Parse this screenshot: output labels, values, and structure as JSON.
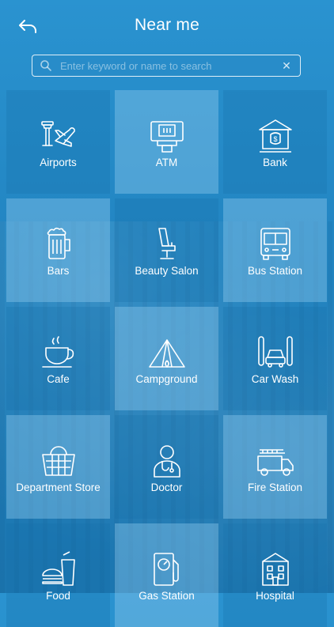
{
  "header": {
    "title": "Near me",
    "back_icon": "back-arrow-icon"
  },
  "search": {
    "placeholder": "Enter keyword or name to search",
    "value": ""
  },
  "categories": [
    {
      "label": "Airports",
      "icon": "airport-icon"
    },
    {
      "label": "ATM",
      "icon": "atm-icon"
    },
    {
      "label": "Bank",
      "icon": "bank-icon"
    },
    {
      "label": "Bars",
      "icon": "beer-mug-icon"
    },
    {
      "label": "Beauty Salon",
      "icon": "salon-chair-icon"
    },
    {
      "label": "Bus Station",
      "icon": "bus-icon"
    },
    {
      "label": "Cafe",
      "icon": "coffee-cup-icon"
    },
    {
      "label": "Campground",
      "icon": "tent-icon"
    },
    {
      "label": "Car Wash",
      "icon": "car-wash-icon"
    },
    {
      "label": "Department Store",
      "icon": "basket-icon"
    },
    {
      "label": "Doctor",
      "icon": "doctor-icon"
    },
    {
      "label": "Fire Station",
      "icon": "fire-truck-icon"
    },
    {
      "label": "Food",
      "icon": "food-icon"
    },
    {
      "label": "Gas Station",
      "icon": "gas-pump-icon"
    },
    {
      "label": "Hospital",
      "icon": "hospital-icon"
    }
  ],
  "colors": {
    "accent": "#2a93d0",
    "text": "#ffffff"
  }
}
